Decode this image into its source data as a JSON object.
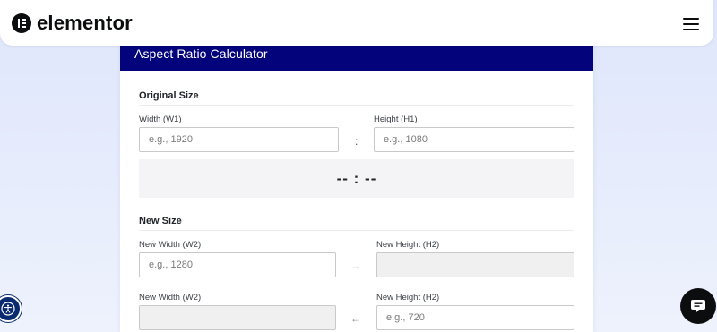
{
  "header": {
    "brand": "elementor",
    "logo_icon": "elementor-logo-icon",
    "menu_icon": "hamburger-menu-icon"
  },
  "calculator": {
    "title": "Aspect Ratio Calculator",
    "accent_color": "#03037b",
    "original_size": {
      "title": "Original Size",
      "width_label": "Width (W1)",
      "width_placeholder": "e.g., 1920",
      "height_label": "Height (H1)",
      "height_placeholder": "e.g., 1080",
      "separator": ":"
    },
    "result": "-- : --",
    "new_size": {
      "title": "New Size",
      "row1": {
        "width_label": "New Width (W2)",
        "width_placeholder": "e.g., 1280",
        "arrow": "→",
        "height_label": "New Height (H2)",
        "height_placeholder": ""
      },
      "row2": {
        "width_label": "New Width (W2)",
        "width_placeholder": "",
        "arrow": "←",
        "height_label": "New Height (H2)",
        "height_placeholder": "e.g., 720"
      }
    }
  },
  "floating": {
    "accessibility_icon": "accessibility-icon",
    "chat_icon": "chat-icon"
  }
}
